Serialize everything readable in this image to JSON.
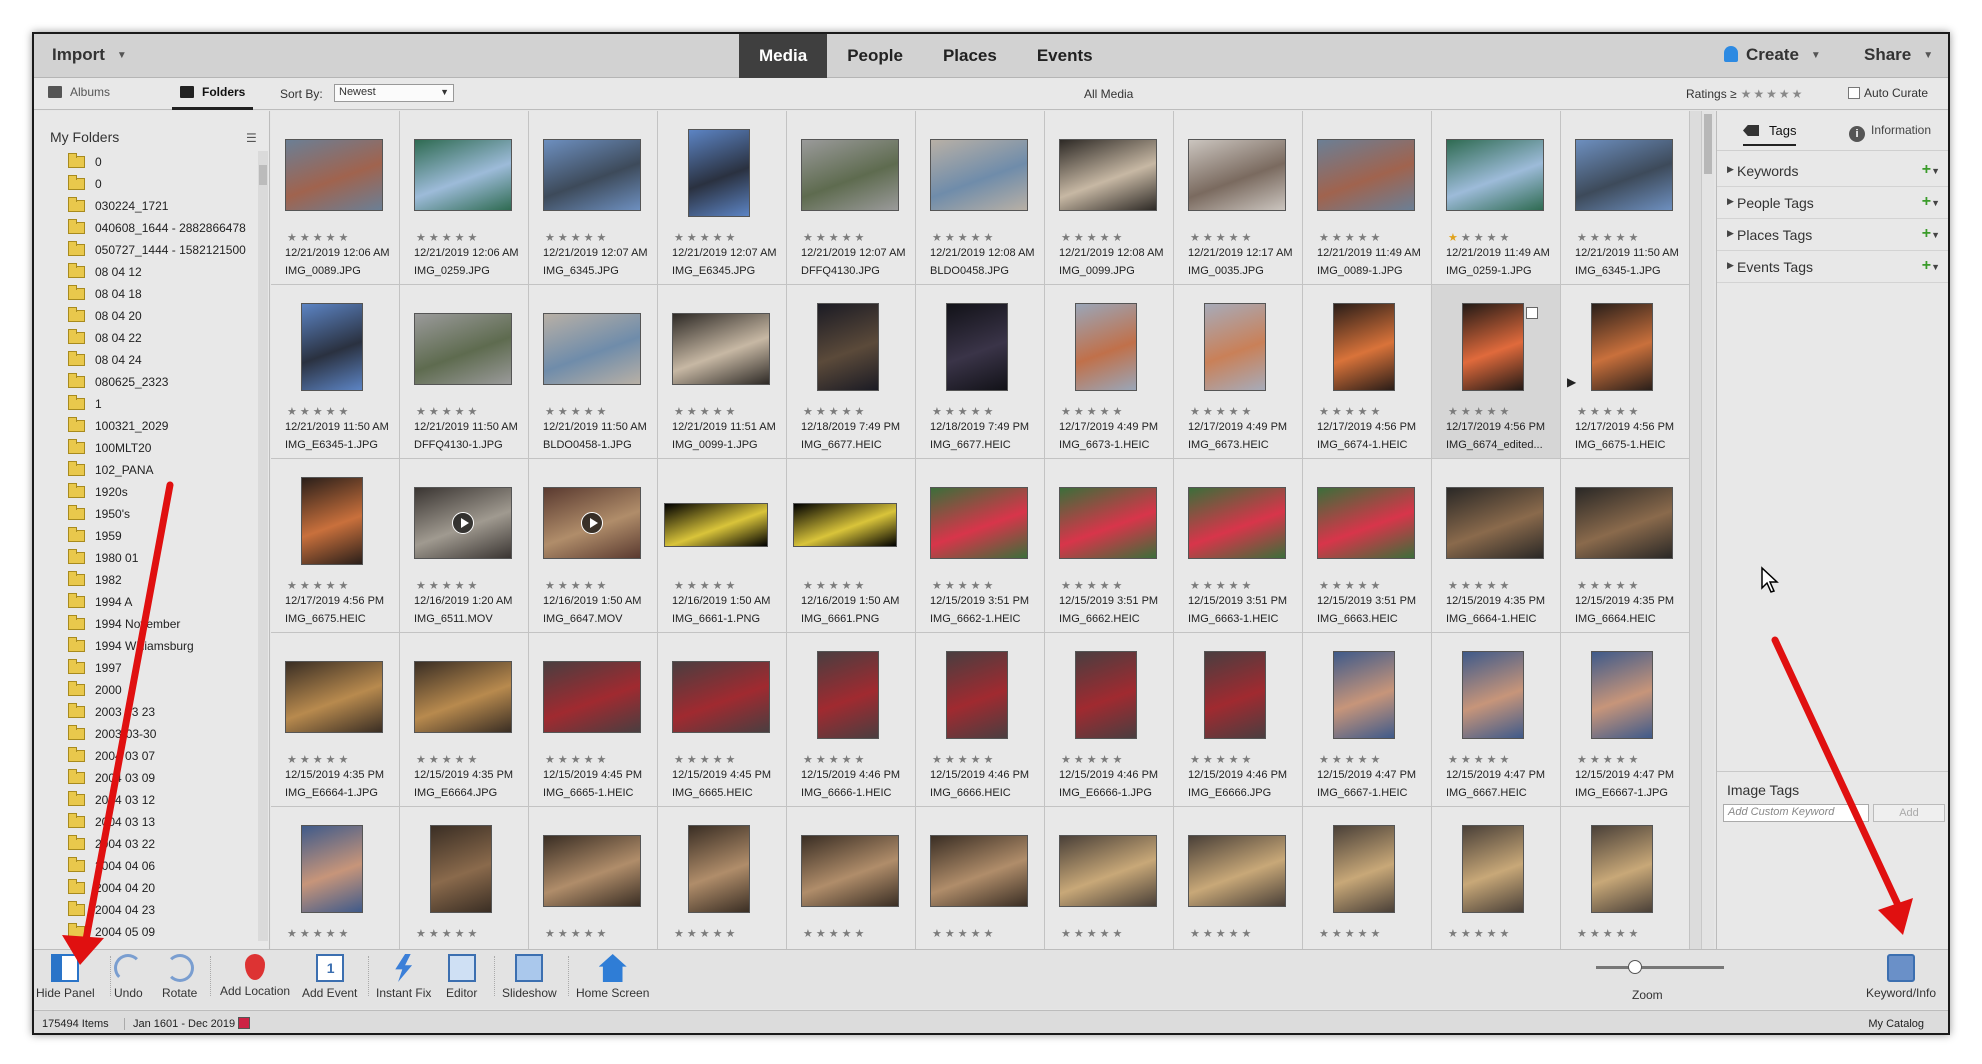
{
  "topbar": {
    "import": "Import",
    "tabs": [
      "Media",
      "People",
      "Places",
      "Events"
    ],
    "active_tab": "Media",
    "create": "Create",
    "share": "Share"
  },
  "subbar": {
    "albums": "Albums",
    "folders": "Folders",
    "sort_by_label": "Sort By:",
    "sort_by_value": "Newest",
    "view_title": "All Media",
    "ratings_label": "Ratings",
    "ratings_op": "≥",
    "auto_curate": "Auto Curate"
  },
  "left_panel": {
    "title": "My Folders",
    "folders": [
      "0",
      "0",
      "030224_1721",
      "040608_1644 - 2882866478",
      "050727_1444 - 1582121500",
      "08 04 12",
      "08 04 18",
      "08 04 20",
      "08 04 22",
      "08 04 24",
      "080625_2323",
      "1",
      "100321_2029",
      "100MLT20",
      "102_PANA",
      "1920s",
      "1950's",
      "1959",
      "1980 01",
      "1982",
      "1994 A",
      "1994 November",
      "1994 Williamsburg",
      "1997",
      "2000",
      "2003 03 23",
      "2003-03-30",
      "2004 03 07",
      "2004 03 09",
      "2004 03 12",
      "2004 03 13",
      "2004 03 22",
      "2004 04 06",
      "2004 04 20",
      "2004 04 23",
      "2004 05 09"
    ]
  },
  "media": {
    "items": [
      {
        "date": "12/21/2019 12:06 AM",
        "name": "IMG_0089.JPG",
        "shape": "landscape",
        "colors": [
          "#6b7f95",
          "#a0634e"
        ]
      },
      {
        "date": "12/21/2019 12:06 AM",
        "name": "IMG_0259.JPG",
        "shape": "landscape",
        "colors": [
          "#2f6b52",
          "#9dbbd9"
        ]
      },
      {
        "date": "12/21/2019 12:07 AM",
        "name": "IMG_6345.JPG",
        "shape": "landscape",
        "colors": [
          "#6d8fbf",
          "#3d4a5a"
        ]
      },
      {
        "date": "12/21/2019 12:07 AM",
        "name": "IMG_E6345.JPG",
        "shape": "portrait",
        "colors": [
          "#5c84c4",
          "#2a3140"
        ]
      },
      {
        "date": "12/21/2019 12:07 AM",
        "name": "DFFQ4130.JPG",
        "shape": "landscape",
        "colors": [
          "#9a9a9a",
          "#5e6b4f"
        ]
      },
      {
        "date": "12/21/2019 12:08 AM",
        "name": "BLDO0458.JPG",
        "shape": "landscape",
        "colors": [
          "#b8b0a6",
          "#6f8caa"
        ]
      },
      {
        "date": "12/21/2019 12:08 AM",
        "name": "IMG_0099.JPG",
        "shape": "landscape",
        "colors": [
          "#2e2a26",
          "#c7b8a4"
        ]
      },
      {
        "date": "12/21/2019 12:17 AM",
        "name": "IMG_0035.JPG",
        "shape": "landscape",
        "colors": [
          "#cbc5bf",
          "#7a6a5f"
        ]
      },
      {
        "date": "12/21/2019 11:49 AM",
        "name": "IMG_0089-1.JPG",
        "shape": "landscape",
        "colors": [
          "#6b7f95",
          "#a0634e"
        ]
      },
      {
        "date": "12/21/2019 11:49 AM",
        "name": "IMG_0259-1.JPG",
        "shape": "landscape",
        "colors": [
          "#2f6b52",
          "#9dbbd9"
        ],
        "gold": true
      },
      {
        "date": "12/21/2019 11:50 AM",
        "name": "IMG_6345-1.JPG",
        "shape": "landscape",
        "colors": [
          "#6d8fbf",
          "#3d4a5a"
        ]
      },
      {
        "date": "12/21/2019 11:50 AM",
        "name": "IMG_E6345-1.JPG",
        "shape": "portrait",
        "colors": [
          "#5c84c4",
          "#2a3140"
        ]
      },
      {
        "date": "12/21/2019 11:50 AM",
        "name": "DFFQ4130-1.JPG",
        "shape": "landscape",
        "colors": [
          "#9a9a9a",
          "#5e6b4f"
        ]
      },
      {
        "date": "12/21/2019 11:50 AM",
        "name": "BLDO0458-1.JPG",
        "shape": "landscape",
        "colors": [
          "#b8b0a6",
          "#6f8caa"
        ]
      },
      {
        "date": "12/21/2019 11:51 AM",
        "name": "IMG_0099-1.JPG",
        "shape": "landscape",
        "colors": [
          "#2e2a26",
          "#c7b8a4"
        ]
      },
      {
        "date": "12/18/2019 7:49 PM",
        "name": "IMG_6677.HEIC",
        "shape": "portrait",
        "colors": [
          "#1b1b24",
          "#5b4a3a"
        ]
      },
      {
        "date": "12/18/2019 7:49 PM",
        "name": "IMG_6677.HEIC",
        "shape": "portrait",
        "colors": [
          "#121218",
          "#3a3448"
        ]
      },
      {
        "date": "12/17/2019 4:49 PM",
        "name": "IMG_6673-1.HEIC",
        "shape": "portrait",
        "colors": [
          "#9aa6b8",
          "#c0704a"
        ]
      },
      {
        "date": "12/17/2019 4:49 PM",
        "name": "IMG_6673.HEIC",
        "shape": "portrait",
        "colors": [
          "#a7abb9",
          "#c98058"
        ]
      },
      {
        "date": "12/17/2019 4:56 PM",
        "name": "IMG_6674-1.HEIC",
        "shape": "portrait",
        "colors": [
          "#2a1d18",
          "#d9733a"
        ]
      },
      {
        "date": "12/17/2019 4:56 PM",
        "name": "IMG_6674_edited...",
        "shape": "portrait",
        "colors": [
          "#231a16",
          "#e06a3c"
        ],
        "selected": true
      },
      {
        "date": "12/17/2019 4:56 PM",
        "name": "IMG_6675-1.HEIC",
        "shape": "portrait",
        "colors": [
          "#2a1f1a",
          "#c9703c"
        ]
      },
      {
        "date": "12/17/2019 4:56 PM",
        "name": "IMG_6675.HEIC",
        "shape": "portrait",
        "colors": [
          "#2a1f1a",
          "#c9703c"
        ]
      },
      {
        "date": "12/16/2019 1:20 AM",
        "name": "IMG_6511.MOV",
        "shape": "landscape",
        "colors": [
          "#3a3532",
          "#a09a90"
        ],
        "video": true
      },
      {
        "date": "12/16/2019 1:50 AM",
        "name": "IMG_6647.MOV",
        "shape": "landscape",
        "colors": [
          "#5a3a30",
          "#b08d6a"
        ],
        "video": true
      },
      {
        "date": "12/16/2019 1:50 AM",
        "name": "IMG_6661-1.PNG",
        "shape": "wide",
        "colors": [
          "#000000",
          "#d9c43a"
        ]
      },
      {
        "date": "12/16/2019 1:50 AM",
        "name": "IMG_6661.PNG",
        "shape": "wide",
        "colors": [
          "#000000",
          "#d9c43a"
        ]
      },
      {
        "date": "12/15/2019 3:51 PM",
        "name": "IMG_6662-1.HEIC",
        "shape": "landscape",
        "colors": [
          "#3c6e3a",
          "#d8354a"
        ]
      },
      {
        "date": "12/15/2019 3:51 PM",
        "name": "IMG_6662.HEIC",
        "shape": "landscape",
        "colors": [
          "#3c6e3a",
          "#d8354a"
        ]
      },
      {
        "date": "12/15/2019 3:51 PM",
        "name": "IMG_6663-1.HEIC",
        "shape": "landscape",
        "colors": [
          "#3c6e3a",
          "#d8354a"
        ]
      },
      {
        "date": "12/15/2019 3:51 PM",
        "name": "IMG_6663.HEIC",
        "shape": "landscape",
        "colors": [
          "#3c6e3a",
          "#d8354a"
        ]
      },
      {
        "date": "12/15/2019 4:35 PM",
        "name": "IMG_6664-1.HEIC",
        "shape": "landscape",
        "colors": [
          "#2a2826",
          "#8a6a4c"
        ]
      },
      {
        "date": "12/15/2019 4:35 PM",
        "name": "IMG_6664.HEIC",
        "shape": "landscape",
        "colors": [
          "#2a2826",
          "#8a6a4c"
        ]
      },
      {
        "date": "12/15/2019 4:35 PM",
        "name": "IMG_E6664-1.JPG",
        "shape": "landscape",
        "colors": [
          "#3a2e24",
          "#b88a4e"
        ]
      },
      {
        "date": "12/15/2019 4:35 PM",
        "name": "IMG_E6664.JPG",
        "shape": "landscape",
        "colors": [
          "#3a2e24",
          "#b88a4e"
        ]
      },
      {
        "date": "12/15/2019 4:45 PM",
        "name": "IMG_6665-1.HEIC",
        "shape": "landscape",
        "colors": [
          "#4a3e40",
          "#a02a30"
        ]
      },
      {
        "date": "12/15/2019 4:45 PM",
        "name": "IMG_6665.HEIC",
        "shape": "landscape",
        "colors": [
          "#4a3e40",
          "#a02a30"
        ]
      },
      {
        "date": "12/15/2019 4:46 PM",
        "name": "IMG_6666-1.HEIC",
        "shape": "portrait",
        "colors": [
          "#4a3e40",
          "#a02a30"
        ]
      },
      {
        "date": "12/15/2019 4:46 PM",
        "name": "IMG_6666.HEIC",
        "shape": "portrait",
        "colors": [
          "#4a3e40",
          "#a02a30"
        ]
      },
      {
        "date": "12/15/2019 4:46 PM",
        "name": "IMG_E6666-1.JPG",
        "shape": "portrait",
        "colors": [
          "#4a3e40",
          "#a02a30"
        ]
      },
      {
        "date": "12/15/2019 4:46 PM",
        "name": "IMG_E6666.JPG",
        "shape": "portrait",
        "colors": [
          "#4a3e40",
          "#a02a30"
        ]
      },
      {
        "date": "12/15/2019 4:47 PM",
        "name": "IMG_6667-1.HEIC",
        "shape": "portrait",
        "colors": [
          "#3f5a8a",
          "#c7957a"
        ]
      },
      {
        "date": "12/15/2019 4:47 PM",
        "name": "IMG_6667.HEIC",
        "shape": "portrait",
        "colors": [
          "#3f5a8a",
          "#c7957a"
        ]
      },
      {
        "date": "12/15/2019 4:47 PM",
        "name": "IMG_E6667-1.JPG",
        "shape": "portrait",
        "colors": [
          "#3f5a8a",
          "#c7957a"
        ]
      },
      {
        "date": "",
        "name": "",
        "shape": "portrait",
        "colors": [
          "#3f5a8a",
          "#c7957a"
        ]
      },
      {
        "date": "",
        "name": "",
        "shape": "portrait",
        "colors": [
          "#3a2e24",
          "#8a6a4c"
        ]
      },
      {
        "date": "",
        "name": "",
        "shape": "landscape",
        "colors": [
          "#3a2e24",
          "#b08d6a"
        ]
      },
      {
        "date": "",
        "name": "",
        "shape": "portrait",
        "colors": [
          "#3a2e24",
          "#b08d6a"
        ]
      },
      {
        "date": "",
        "name": "",
        "shape": "landscape",
        "colors": [
          "#3a2e24",
          "#b08d6a"
        ]
      },
      {
        "date": "",
        "name": "",
        "shape": "landscape",
        "colors": [
          "#3a2e24",
          "#b08d6a"
        ]
      },
      {
        "date": "",
        "name": "",
        "shape": "landscape",
        "colors": [
          "#4a4038",
          "#c8a878"
        ]
      },
      {
        "date": "",
        "name": "",
        "shape": "landscape",
        "colors": [
          "#4a4038",
          "#c8a878"
        ]
      },
      {
        "date": "",
        "name": "",
        "shape": "portrait",
        "colors": [
          "#4a4038",
          "#c8a878"
        ]
      },
      {
        "date": "",
        "name": "",
        "shape": "portrait",
        "colors": [
          "#4a4038",
          "#c8a878"
        ]
      },
      {
        "date": "",
        "name": "",
        "shape": "portrait",
        "colors": [
          "#4a4038",
          "#c8a878"
        ]
      }
    ]
  },
  "right_panel": {
    "tags_tab": "Tags",
    "info_tab": "Information",
    "sections": [
      "Keywords",
      "People Tags",
      "Places Tags",
      "Events Tags"
    ],
    "image_tags_title": "Image Tags",
    "keyword_placeholder": "Add Custom Keyword",
    "add_button": "Add"
  },
  "toolbar": {
    "hide_panel": "Hide Panel",
    "undo": "Undo",
    "rotate": "Rotate",
    "add_location": "Add Location",
    "add_event": "Add Event",
    "instant_fix": "Instant Fix",
    "editor": "Editor",
    "slideshow": "Slideshow",
    "home_screen": "Home Screen",
    "zoom": "Zoom",
    "keyword_info": "Keyword/Info",
    "zoom_level": 0.25
  },
  "status": {
    "items": "175494 Items",
    "range": "Jan 1601 - Dec 2019",
    "catalog": "My Catalog"
  },
  "colors": {
    "accent": "#2d8ae2",
    "annotation_arrow": "#e01010",
    "star_gold": "#e0a21c"
  }
}
